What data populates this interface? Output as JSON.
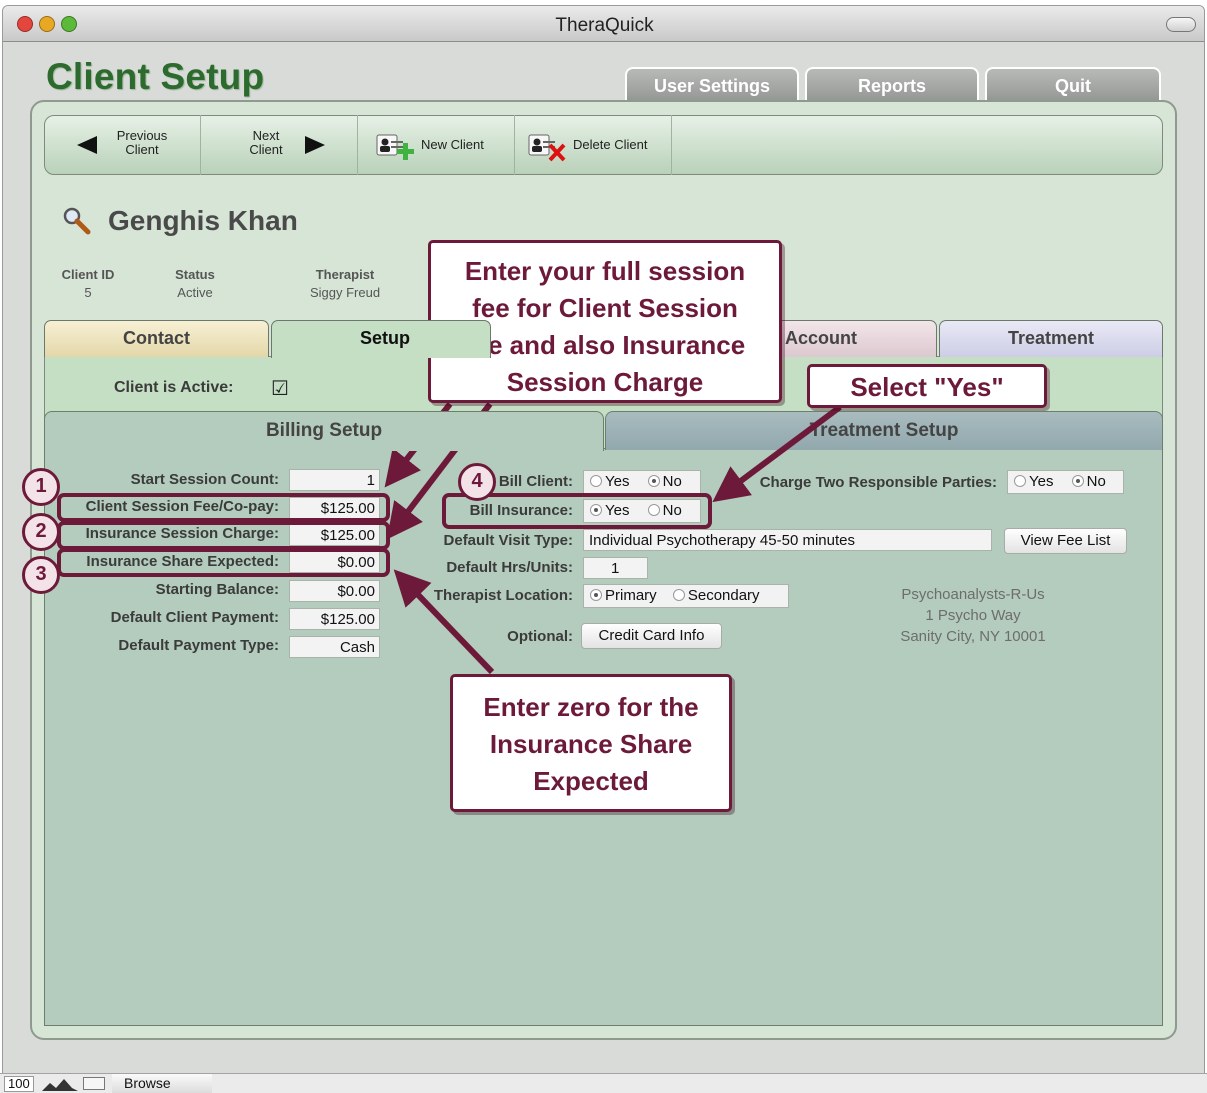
{
  "window": {
    "title": "TheraQuick"
  },
  "page_title": "Client Setup",
  "top_tabs": [
    {
      "label": "User Settings"
    },
    {
      "label": "Reports"
    },
    {
      "label": "Quit"
    }
  ],
  "toolbar": {
    "previous_line1": "Previous",
    "previous_line2": "Client",
    "next_line1": "Next",
    "next_line2": "Client",
    "new_client": "New Client",
    "delete_client": "Delete Client"
  },
  "client": {
    "name": "Genghis Khan",
    "id_label": "Client ID",
    "id_value": "5",
    "status_label": "Status",
    "status_value": "Active",
    "therapist_label": "Therapist",
    "therapist_value": "Siggy Freud"
  },
  "main_tabs": [
    {
      "label": "Contact"
    },
    {
      "label": "Setup"
    },
    {
      "label": "Account"
    },
    {
      "label": "Treatment"
    }
  ],
  "active_label": "Client is Active:",
  "active_check": "☑",
  "subtabs": [
    {
      "label": "Billing Setup"
    },
    {
      "label": "Treatment Setup"
    }
  ],
  "billing": {
    "rows": [
      {
        "label": "Start Session Count:",
        "value": "1"
      },
      {
        "label": "Client Session Fee/Co-pay:",
        "value": "$125.00"
      },
      {
        "label": "Insurance Session Charge:",
        "value": "$125.00"
      },
      {
        "label": "Insurance Share Expected:",
        "value": "$0.00"
      },
      {
        "label": "Starting Balance:",
        "value": "$0.00"
      },
      {
        "label": "Default Client Payment:",
        "value": "$125.00"
      },
      {
        "label": "Default Payment Type:",
        "value": "Cash"
      }
    ]
  },
  "options": {
    "bill_client_label": "Bill Client:",
    "bill_insurance_label": "Bill Insurance:",
    "charge_two_label": "Charge Two Responsible Parties:",
    "yes": "Yes",
    "no": "No",
    "visit_type_label": "Default Visit Type:",
    "visit_type_value": "Individual Psychotherapy 45-50 minutes",
    "view_fee_list": "View Fee List",
    "hrs_label": "Default Hrs/Units:",
    "hrs_value": "1",
    "location_label": "Therapist Location:",
    "primary": "Primary",
    "secondary": "Secondary",
    "optional_label": "Optional:",
    "credit_card": "Credit Card Info"
  },
  "address": {
    "line1": "Psychoanalysts-R-Us",
    "line2": "1 Psycho Way",
    "line3": "Sanity City, NY 10001"
  },
  "callouts": {
    "session_fee": [
      "Enter your full session",
      "fee for Client Session",
      "fee and also Insurance",
      "Session Charge"
    ],
    "select_yes": "Select \"Yes\"",
    "zero_share": [
      "Enter zero for the",
      "Insurance Share",
      "Expected"
    ],
    "numbers": [
      "1",
      "2",
      "3",
      "4"
    ]
  },
  "colors": {
    "callout": "#6d1a3a",
    "title_green": "#2d6a2d"
  },
  "statusbar": {
    "zoom": "100",
    "mode": "Browse"
  }
}
